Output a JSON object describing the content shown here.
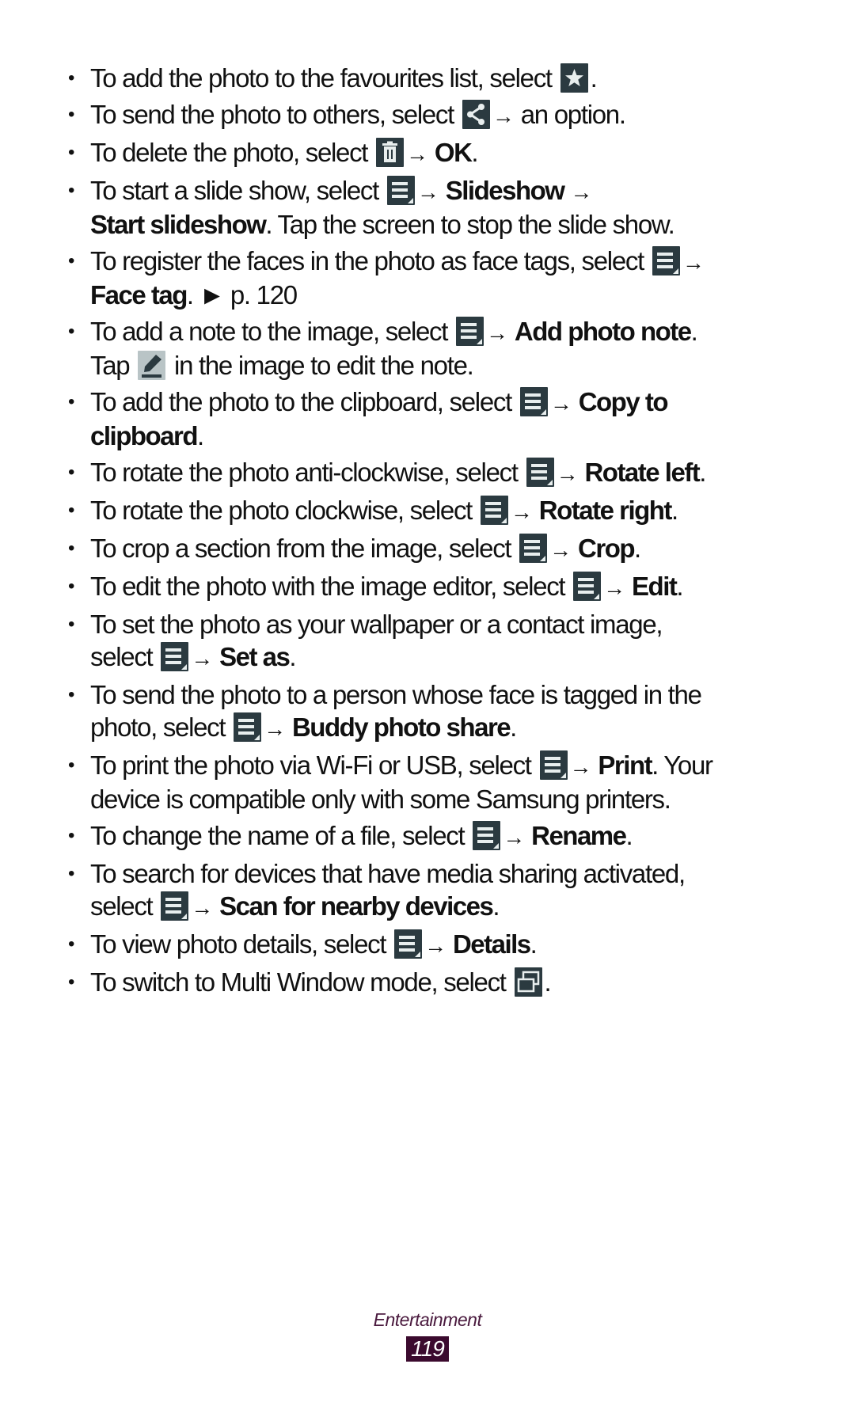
{
  "items": [
    {
      "parts": [
        {
          "t": "To add the photo to the favourites list, select "
        },
        {
          "icon": "star-icon"
        },
        {
          "t": "."
        }
      ]
    },
    {
      "parts": [
        {
          "t": "To send the photo to others, select "
        },
        {
          "icon": "share-icon"
        },
        {
          "arrow": "→"
        },
        {
          "t": " an option."
        }
      ]
    },
    {
      "parts": [
        {
          "t": "To delete the photo, select "
        },
        {
          "icon": "trash-icon"
        },
        {
          "arrow": "→"
        },
        {
          "t": " "
        },
        {
          "b": "OK"
        },
        {
          "t": "."
        }
      ]
    },
    {
      "parts": [
        {
          "t": "To start a slide show, select "
        },
        {
          "icon": "menu-icon"
        },
        {
          "arrow": "→"
        },
        {
          "t": " "
        },
        {
          "b": "Slideshow"
        },
        {
          "t": " "
        },
        {
          "arrow": "→"
        },
        {
          "br": true
        },
        {
          "b": "Start slideshow"
        },
        {
          "t": ". Tap the screen to stop the slide show."
        }
      ]
    },
    {
      "parts": [
        {
          "t": "To register the faces in the photo as face tags, select "
        },
        {
          "icon": "menu-icon"
        },
        {
          "arrow": "→"
        },
        {
          "br": true
        },
        {
          "b": "Face tag"
        },
        {
          "t": ". ► p. 120"
        }
      ]
    },
    {
      "parts": [
        {
          "t": "To add a note to the image, select "
        },
        {
          "icon": "menu-icon"
        },
        {
          "arrow": "→"
        },
        {
          "t": " "
        },
        {
          "b": "Add photo note"
        },
        {
          "t": "."
        },
        {
          "br": true
        },
        {
          "t": "Tap "
        },
        {
          "icon": "pencil-icon"
        },
        {
          "t": " in the image to edit the note."
        }
      ]
    },
    {
      "parts": [
        {
          "t": "To add the photo to the clipboard, select "
        },
        {
          "icon": "menu-icon"
        },
        {
          "arrow": "→"
        },
        {
          "t": " "
        },
        {
          "b": "Copy to"
        },
        {
          "br": true
        },
        {
          "b": "clipboard"
        },
        {
          "t": "."
        }
      ]
    },
    {
      "parts": [
        {
          "t": "To rotate the photo anti-clockwise, select "
        },
        {
          "icon": "menu-icon"
        },
        {
          "arrow": "→"
        },
        {
          "t": " "
        },
        {
          "b": "Rotate left"
        },
        {
          "t": "."
        }
      ]
    },
    {
      "parts": [
        {
          "t": "To rotate the photo clockwise, select "
        },
        {
          "icon": "menu-icon"
        },
        {
          "arrow": "→"
        },
        {
          "t": " "
        },
        {
          "b": "Rotate right"
        },
        {
          "t": "."
        }
      ]
    },
    {
      "parts": [
        {
          "t": "To crop a section from the image, select "
        },
        {
          "icon": "menu-icon"
        },
        {
          "arrow": "→"
        },
        {
          "t": " "
        },
        {
          "b": "Crop"
        },
        {
          "t": "."
        }
      ]
    },
    {
      "parts": [
        {
          "t": "To edit the photo with the image editor, select "
        },
        {
          "icon": "menu-icon"
        },
        {
          "arrow": "→"
        },
        {
          "t": " "
        },
        {
          "b": "Edit"
        },
        {
          "t": "."
        }
      ]
    },
    {
      "parts": [
        {
          "t": "To set the photo as your wallpaper or a contact image,"
        },
        {
          "br": true
        },
        {
          "t": "select "
        },
        {
          "icon": "menu-icon"
        },
        {
          "arrow": "→"
        },
        {
          "t": " "
        },
        {
          "b": "Set as"
        },
        {
          "t": "."
        }
      ]
    },
    {
      "parts": [
        {
          "t": "To send the photo to a person whose face is tagged in the"
        },
        {
          "br": true
        },
        {
          "t": "photo, select "
        },
        {
          "icon": "menu-icon"
        },
        {
          "arrow": "→"
        },
        {
          "t": " "
        },
        {
          "b": "Buddy photo share"
        },
        {
          "t": "."
        }
      ]
    },
    {
      "parts": [
        {
          "t": "To print the photo via Wi-Fi or USB, select "
        },
        {
          "icon": "menu-icon"
        },
        {
          "arrow": "→"
        },
        {
          "t": " "
        },
        {
          "b": "Print"
        },
        {
          "t": ". Your"
        },
        {
          "br": true
        },
        {
          "t": "device is compatible only with some Samsung printers."
        }
      ]
    },
    {
      "parts": [
        {
          "t": "To change the name of a file, select "
        },
        {
          "icon": "menu-icon"
        },
        {
          "arrow": "→"
        },
        {
          "t": " "
        },
        {
          "b": "Rename"
        },
        {
          "t": "."
        }
      ]
    },
    {
      "parts": [
        {
          "t": "To search for devices that have media sharing activated,"
        },
        {
          "br": true
        },
        {
          "t": "select "
        },
        {
          "icon": "menu-icon"
        },
        {
          "arrow": "→"
        },
        {
          "t": " "
        },
        {
          "b": "Scan for nearby devices"
        },
        {
          "t": "."
        }
      ]
    },
    {
      "parts": [
        {
          "t": "To view photo details, select "
        },
        {
          "icon": "menu-icon"
        },
        {
          "arrow": "→"
        },
        {
          "t": " "
        },
        {
          "b": "Details"
        },
        {
          "t": "."
        }
      ]
    },
    {
      "parts": [
        {
          "t": "To switch to Multi Window mode, select "
        },
        {
          "icon": "multi-window-icon"
        },
        {
          "t": "."
        }
      ]
    }
  ],
  "bullet_char": "•",
  "footer": {
    "section": "Entertainment",
    "page_number": "119"
  }
}
